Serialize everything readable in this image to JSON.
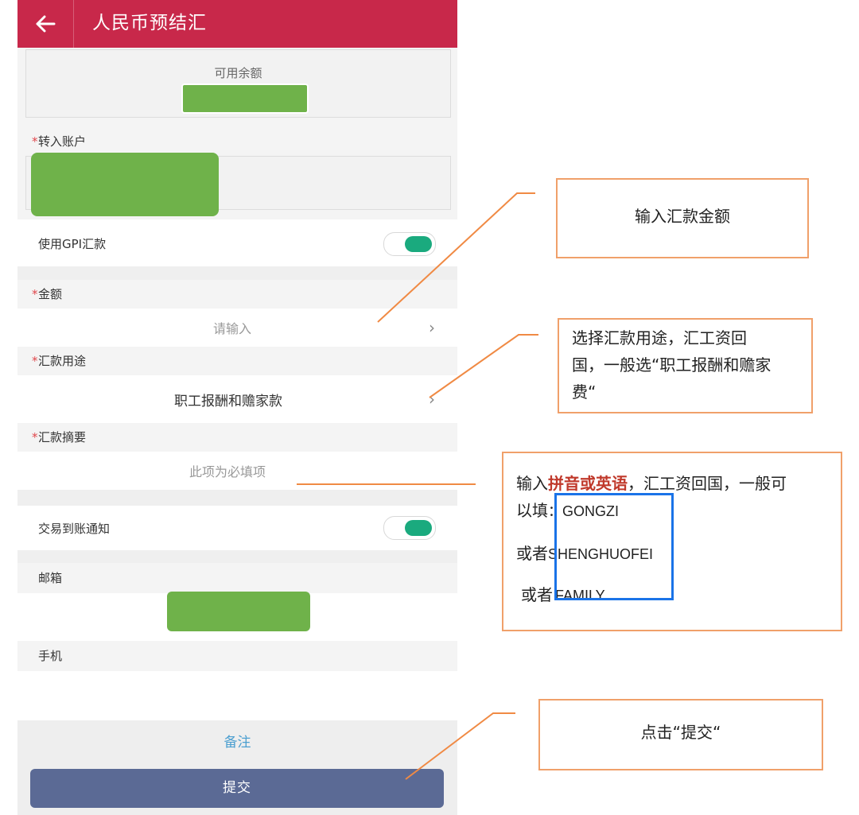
{
  "header": {
    "title": "人民币预结汇"
  },
  "balance": {
    "label": "可用余额"
  },
  "account": {
    "label": "转入账户"
  },
  "gpi": {
    "label": "使用GPI汇款"
  },
  "amount": {
    "label": "金额",
    "placeholder": "请输入"
  },
  "purpose": {
    "label": "汇款用途",
    "value": "职工报酬和赡家款"
  },
  "summary": {
    "label": "汇款摘要",
    "placeholder": "此项为必填项"
  },
  "notify": {
    "label": "交易到账通知"
  },
  "email": {
    "label": "邮箱"
  },
  "phone": {
    "label": "手机"
  },
  "note": {
    "label": "备注"
  },
  "submit": {
    "label": "提交"
  },
  "colors": {
    "header": "#c8284a",
    "toggle_on": "#1aaa7e",
    "submit": "#5b6a95",
    "callout_border": "#f0a06a",
    "highlight_blue": "#1a73e8",
    "highlight_red": "#c0392b"
  },
  "annotations": {
    "amount_tip": "输入汇款金额",
    "purpose_tip_line1": "选择汇款用途，汇工资回",
    "purpose_tip_line2": "国，一般选“职工报酬和赡家",
    "purpose_tip_line3": "费“",
    "summary_tip_prefix": "输入",
    "summary_tip_highlight": "拼音或英语",
    "summary_tip_suffix": "，汇工资回国，一般可",
    "summary_tip_line2": "以填",
    "summary_opt1": "：GONGZI",
    "summary_or": "或者",
    "summary_opt2": "SHENGHUOFEI",
    "summary_or2": "或者",
    "summary_opt3": "FAMILY",
    "submit_tip": "点击“提交“"
  }
}
